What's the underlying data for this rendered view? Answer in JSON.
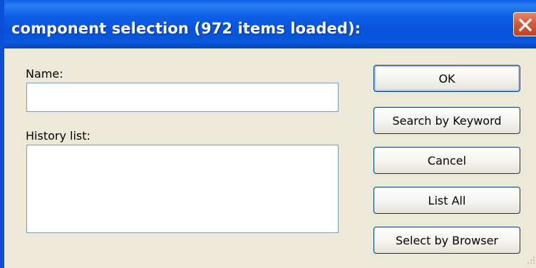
{
  "window": {
    "title": "component selection (972 items loaded):",
    "close_icon": "close-x-icon"
  },
  "form": {
    "name_label": "Name:",
    "name_value": "",
    "history_label": "History list:",
    "history_items": []
  },
  "buttons": {
    "ok": "OK",
    "search_by_keyword": "Search by Keyword",
    "cancel": "Cancel",
    "list_all": "List All",
    "select_by_browser": "Select by Browser"
  },
  "colors": {
    "titlebar": "#0a56dd",
    "close_button": "#d55b3a",
    "dialog_bg": "#ece9d8",
    "field_border": "#7f9db9",
    "button_border": "#003c74"
  }
}
